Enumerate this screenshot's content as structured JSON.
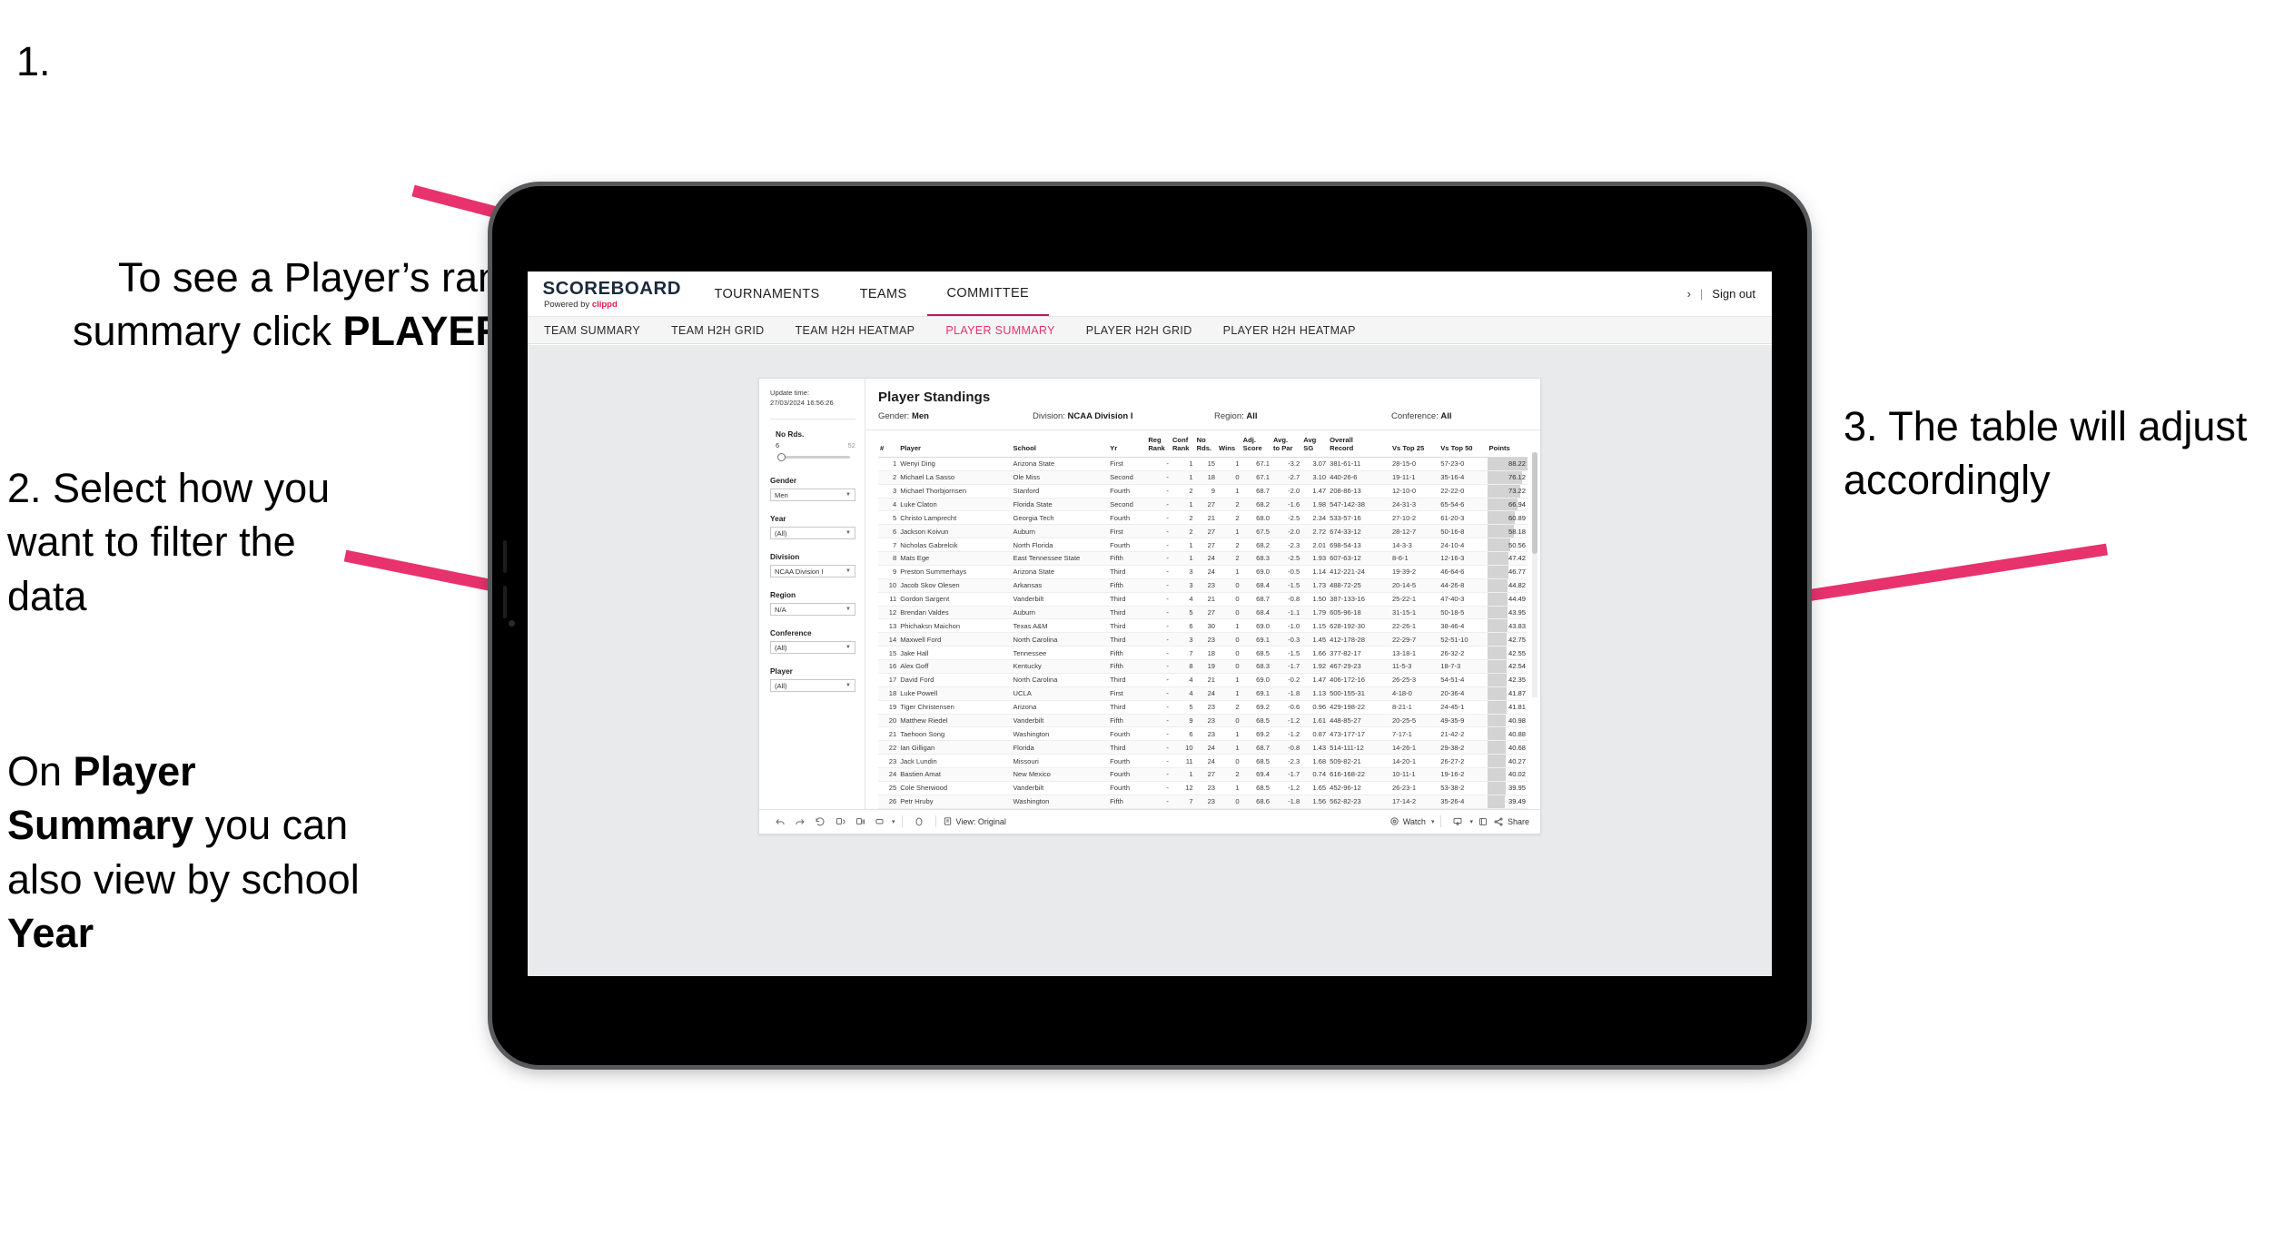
{
  "annotations": {
    "step1_num": "1.",
    "step1_pre": "To see a Player’s rankings summary click ",
    "step1_bold": "PLAYER SUMMARY",
    "step2": "2. Select how you want to filter the data",
    "step3_pre": "On ",
    "step3_b1": "Player Summary",
    "step3_mid": " you can also view by school ",
    "step3_b2": "Year",
    "step4": "3. The table will adjust accordingly",
    "arrow_color": "#e8326d"
  },
  "app": {
    "logo": {
      "word": "SCOREBOARD",
      "powered_by": "Powered by ",
      "brand": "clippd"
    },
    "topnav": [
      {
        "label": "TOURNAMENTS",
        "active": false
      },
      {
        "label": "TEAMS",
        "active": false
      },
      {
        "label": "COMMITTEE",
        "active": true
      }
    ],
    "signout": {
      "chevron": "›",
      "divider": "|",
      "label": "Sign out"
    },
    "subnav": [
      {
        "label": "TEAM SUMMARY",
        "active": false
      },
      {
        "label": "TEAM H2H GRID",
        "active": false
      },
      {
        "label": "TEAM H2H HEATMAP",
        "active": false
      },
      {
        "label": "PLAYER SUMMARY",
        "active": true
      },
      {
        "label": "PLAYER H2H GRID",
        "active": false
      },
      {
        "label": "PLAYER H2H HEATMAP",
        "active": false
      }
    ],
    "accent": "#e8336b"
  },
  "viz": {
    "title": "Player Standings",
    "update_time_label": "Update time:",
    "update_time_value": "27/03/2024 16:56:26",
    "filter_summary": [
      {
        "label": "Gender: ",
        "value": "Men"
      },
      {
        "label": "Division: ",
        "value": "NCAA Division I"
      },
      {
        "label": "Region: ",
        "value": "All"
      },
      {
        "label": "Conference: ",
        "value": "All"
      }
    ],
    "slider": {
      "title": "No Rds.",
      "min": "6",
      "max": "52"
    },
    "filters": [
      {
        "title": "Gender",
        "value": "Men"
      },
      {
        "title": "Year",
        "value": "(All)"
      },
      {
        "title": "Division",
        "value": "NCAA Division I"
      },
      {
        "title": "Region",
        "value": "N/A"
      },
      {
        "title": "Conference",
        "value": "(All)"
      },
      {
        "title": "Player",
        "value": "(All)"
      }
    ],
    "columns": [
      "#",
      "Player",
      "School",
      "Yr",
      "Reg Rank",
      "Conf Rank",
      "No Rds.",
      "Wins",
      "Adj. Score",
      "Avg. to Par",
      "Avg SG",
      "Overall Record",
      "Vs Top 25",
      "Vs Top 50",
      "Points"
    ],
    "rows": [
      [
        "1",
        "Wenyi Ding",
        "Arizona State",
        "First",
        "-",
        "1",
        "15",
        "1",
        "67.1",
        "-3.2",
        "3.07",
        "381-61-11",
        "28-15-0",
        "57-23-0",
        "88.22"
      ],
      [
        "2",
        "Michael La Sasso",
        "Ole Miss",
        "Second",
        "-",
        "1",
        "18",
        "0",
        "67.1",
        "-2.7",
        "3.10",
        "440-26-6",
        "19-11-1",
        "35-16-4",
        "76.12"
      ],
      [
        "3",
        "Michael Thorbjornsen",
        "Stanford",
        "Fourth",
        "-",
        "2",
        "9",
        "1",
        "68.7",
        "-2.0",
        "1.47",
        "208-86-13",
        "12-10-0",
        "22-22-0",
        "73.22"
      ],
      [
        "4",
        "Luke Claton",
        "Florida State",
        "Second",
        "-",
        "1",
        "27",
        "2",
        "68.2",
        "-1.6",
        "1.98",
        "547-142-38",
        "24-31-3",
        "65-54-6",
        "66.94"
      ],
      [
        "5",
        "Christo Lamprecht",
        "Georgia Tech",
        "Fourth",
        "-",
        "2",
        "21",
        "2",
        "68.0",
        "-2.5",
        "2.34",
        "533-57-16",
        "27-10-2",
        "61-20-3",
        "60.89"
      ],
      [
        "6",
        "Jackson Koivun",
        "Auburn",
        "First",
        "-",
        "2",
        "27",
        "1",
        "67.5",
        "-2.0",
        "2.72",
        "674-33-12",
        "28-12-7",
        "50-16-8",
        "58.18"
      ],
      [
        "7",
        "Nicholas Gabrelcik",
        "North Florida",
        "Fourth",
        "-",
        "1",
        "27",
        "2",
        "68.2",
        "-2.3",
        "2.01",
        "698-54-13",
        "14-3-3",
        "24-10-4",
        "50.56"
      ],
      [
        "8",
        "Mats Ege",
        "East Tennessee State",
        "Fifth",
        "-",
        "1",
        "24",
        "2",
        "68.3",
        "-2.5",
        "1.93",
        "607-63-12",
        "8-6-1",
        "12-16-3",
        "47.42"
      ],
      [
        "9",
        "Preston Summerhays",
        "Arizona State",
        "Third",
        "-",
        "3",
        "24",
        "1",
        "69.0",
        "-0.5",
        "1.14",
        "412-221-24",
        "19-39-2",
        "46-64-6",
        "46.77"
      ],
      [
        "10",
        "Jacob Skov Olesen",
        "Arkansas",
        "Fifth",
        "-",
        "3",
        "23",
        "0",
        "68.4",
        "-1.5",
        "1.73",
        "488-72-25",
        "20-14-5",
        "44-26-8",
        "44.82"
      ],
      [
        "11",
        "Gordon Sargent",
        "Vanderbilt",
        "Third",
        "-",
        "4",
        "21",
        "0",
        "68.7",
        "-0.8",
        "1.50",
        "387-133-16",
        "25-22-1",
        "47-40-3",
        "44.49"
      ],
      [
        "12",
        "Brendan Valdes",
        "Auburn",
        "Third",
        "-",
        "5",
        "27",
        "0",
        "68.4",
        "-1.1",
        "1.79",
        "605-96-18",
        "31-15-1",
        "50-18-5",
        "43.95"
      ],
      [
        "13",
        "Phichaksn Maichon",
        "Texas A&M",
        "Third",
        "-",
        "6",
        "30",
        "1",
        "69.0",
        "-1.0",
        "1.15",
        "628-192-30",
        "22-26-1",
        "38-46-4",
        "43.83"
      ],
      [
        "14",
        "Maxwell Ford",
        "North Carolina",
        "Third",
        "-",
        "3",
        "23",
        "0",
        "69.1",
        "-0.3",
        "1.45",
        "412-178-28",
        "22-29-7",
        "52-51-10",
        "42.75"
      ],
      [
        "15",
        "Jake Hall",
        "Tennessee",
        "Fifth",
        "-",
        "7",
        "18",
        "0",
        "68.5",
        "-1.5",
        "1.66",
        "377-82-17",
        "13-18-1",
        "26-32-2",
        "42.55"
      ],
      [
        "16",
        "Alex Goff",
        "Kentucky",
        "Fifth",
        "-",
        "8",
        "19",
        "0",
        "68.3",
        "-1.7",
        "1.92",
        "467-29-23",
        "11-5-3",
        "18-7-3",
        "42.54"
      ],
      [
        "17",
        "David Ford",
        "North Carolina",
        "Third",
        "-",
        "4",
        "21",
        "1",
        "69.0",
        "-0.2",
        "1.47",
        "406-172-16",
        "26-25-3",
        "54-51-4",
        "42.35"
      ],
      [
        "18",
        "Luke Powell",
        "UCLA",
        "First",
        "-",
        "4",
        "24",
        "1",
        "69.1",
        "-1.8",
        "1.13",
        "500-155-31",
        "4-18-0",
        "20-36-4",
        "41.87"
      ],
      [
        "19",
        "Tiger Christensen",
        "Arizona",
        "Third",
        "-",
        "5",
        "23",
        "2",
        "69.2",
        "-0.6",
        "0.96",
        "429-198-22",
        "8-21-1",
        "24-45-1",
        "41.81"
      ],
      [
        "20",
        "Matthew Riedel",
        "Vanderbilt",
        "Fifth",
        "-",
        "9",
        "23",
        "0",
        "68.5",
        "-1.2",
        "1.61",
        "448-85-27",
        "20-25-5",
        "49-35-9",
        "40.98"
      ],
      [
        "21",
        "Taehoon Song",
        "Washington",
        "Fourth",
        "-",
        "6",
        "23",
        "1",
        "69.2",
        "-1.2",
        "0.87",
        "473-177-17",
        "7-17-1",
        "21-42-2",
        "40.88"
      ],
      [
        "22",
        "Ian Gilligan",
        "Florida",
        "Third",
        "-",
        "10",
        "24",
        "1",
        "68.7",
        "-0.8",
        "1.43",
        "514-111-12",
        "14-26-1",
        "29-38-2",
        "40.68"
      ],
      [
        "23",
        "Jack Lundin",
        "Missouri",
        "Fourth",
        "-",
        "11",
        "24",
        "0",
        "68.5",
        "-2.3",
        "1.68",
        "509-82-21",
        "14-20-1",
        "26-27-2",
        "40.27"
      ],
      [
        "24",
        "Bastien Amat",
        "New Mexico",
        "Fourth",
        "-",
        "1",
        "27",
        "2",
        "69.4",
        "-1.7",
        "0.74",
        "616-168-22",
        "10-11-1",
        "19-16-2",
        "40.02"
      ],
      [
        "25",
        "Cole Sherwood",
        "Vanderbilt",
        "Fourth",
        "-",
        "12",
        "23",
        "1",
        "68.5",
        "-1.2",
        "1.65",
        "452-96-12",
        "26-23-1",
        "53-38-2",
        "39.95"
      ],
      [
        "26",
        "Petr Hruby",
        "Washington",
        "Fifth",
        "-",
        "7",
        "23",
        "0",
        "68.6",
        "-1.8",
        "1.56",
        "562-82-23",
        "17-14-2",
        "35-26-4",
        "39.49"
      ]
    ],
    "toolbar": {
      "undo": "undo-icon",
      "redo": "redo-icon",
      "revert": "revert-icon",
      "refresh": "refresh-icon",
      "pause": "pause-icon",
      "view_label": "View: Original",
      "watch_label": "Watch",
      "share_label": "Share"
    }
  }
}
